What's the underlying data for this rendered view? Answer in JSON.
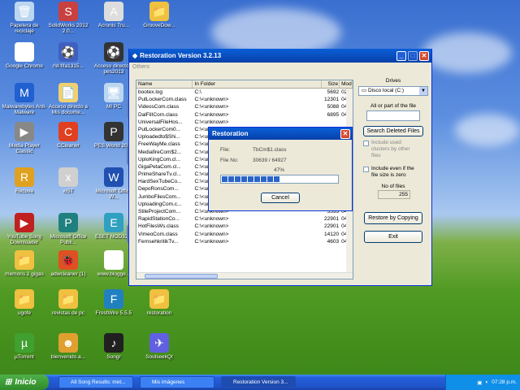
{
  "desktop_icons": [
    {
      "label": "Papelera de reciclaje",
      "icon": "recycle-bin-icon",
      "color": "#bcd6f0",
      "glyph": "🗑"
    },
    {
      "label": "SolidWorks 2012 2.0...",
      "icon": "app-icon",
      "color": "#c84040",
      "glyph": "S"
    },
    {
      "label": "Acronis Tru...",
      "icon": "app-icon",
      "color": "#dddddd",
      "glyph": "A"
    },
    {
      "label": "GrooveDow...",
      "icon": "folder-icon",
      "color": "#f0c040",
      "glyph": "📁"
    },
    {
      "label": "Google Chrome",
      "icon": "chrome-icon",
      "color": "#ffffff",
      "glyph": "◉"
    },
    {
      "label": "rld-fifa1315...",
      "icon": "app-icon",
      "color": "#4060c0",
      "glyph": "⚽"
    },
    {
      "label": "Acceso directo a pes2013",
      "icon": "game-icon",
      "color": "#333333",
      "glyph": "⚽"
    },
    {
      "label": "Malwarebytes Anti-Malware",
      "icon": "malwarebytes-icon",
      "color": "#2060d0",
      "glyph": "M"
    },
    {
      "label": "Acceso directo a Mis docume...",
      "icon": "documents-icon",
      "color": "#f0d070",
      "glyph": "📄"
    },
    {
      "label": "MI PC",
      "icon": "computer-icon",
      "color": "#bcd6f0",
      "glyph": "🖥"
    },
    {
      "label": "aT...",
      "icon": "app-icon",
      "color": "#6080c0",
      "glyph": "a"
    },
    {
      "label": "Media Player Classic",
      "icon": "media-player-icon",
      "color": "#888888",
      "glyph": "▶"
    },
    {
      "label": "CCleaner",
      "icon": "ccleaner-icon",
      "color": "#e04020",
      "glyph": "C"
    },
    {
      "label": "PES World 2012",
      "icon": "game-icon",
      "color": "#333333",
      "glyph": "P"
    },
    {
      "label": "so...",
      "icon": "app-icon",
      "color": "#6080c0",
      "glyph": "s"
    },
    {
      "label": "Recuva",
      "icon": "recuva-icon",
      "color": "#e0a020",
      "glyph": "R"
    },
    {
      "label": "xiST",
      "icon": "app-icon",
      "color": "#d0d0d0",
      "glyph": "x"
    },
    {
      "label": "Microsoft Office W...",
      "icon": "word-icon",
      "color": "#2050b0",
      "glyph": "W"
    },
    {
      "label": "YouTube Song Downloader",
      "icon": "youtube-icon",
      "color": "#c02020",
      "glyph": "▶"
    },
    {
      "label": "Microsoft Office Publi...",
      "icon": "publisher-icon",
      "color": "#208080",
      "glyph": "P"
    },
    {
      "label": "ESET NOD32...",
      "icon": "eset-icon",
      "color": "#30a0c0",
      "glyph": "E"
    },
    {
      "label": "so...",
      "icon": "app-icon",
      "color": "#6080c0",
      "glyph": "s"
    },
    {
      "label": "memoris 2 gigas",
      "icon": "folder-icon",
      "color": "#f0c040",
      "glyph": "📁"
    },
    {
      "label": "adwcleaner (1)",
      "icon": "adwcleaner-icon",
      "color": "#e05020",
      "glyph": "🐞"
    },
    {
      "label": "www.blogge...",
      "icon": "chrome-icon",
      "color": "#ffffff",
      "glyph": "◉"
    },
    {
      "label": "ugofe",
      "icon": "folder-icon",
      "color": "#f0c040",
      "glyph": "📁"
    },
    {
      "label": "revistas de pc",
      "icon": "folder-icon",
      "color": "#f0c040",
      "glyph": "📁"
    },
    {
      "label": "FrostWire 5.5.5",
      "icon": "frostwire-icon",
      "color": "#2080c0",
      "glyph": "F"
    },
    {
      "label": "restoration",
      "icon": "folder-icon",
      "color": "#f0c040",
      "glyph": "📁"
    },
    {
      "label": "µTorrent",
      "icon": "utorrent-icon",
      "color": "#40a030",
      "glyph": "µ"
    },
    {
      "label": "bienvenido.a...",
      "icon": "app-icon",
      "color": "#e0a030",
      "glyph": "☻"
    },
    {
      "label": "Songr",
      "icon": "songr-icon",
      "color": "#202020",
      "glyph": "♪"
    },
    {
      "label": "SoulseekQt",
      "icon": "soulseek-icon",
      "color": "#6060e0",
      "glyph": "✈"
    }
  ],
  "window": {
    "title": "Restoration Version 3.2.13",
    "menu": "Others",
    "columns": [
      "Name",
      "In Folder",
      "Size",
      "Mod"
    ],
    "rows": [
      [
        "bootex.log",
        "C:\\",
        "5692",
        "02/2"
      ],
      [
        "PutLockerCom.class",
        "C:\\<unknown>",
        "12301",
        "04/0"
      ],
      [
        "VideosCom.class",
        "C:\\<unknown>",
        "5088",
        "04/0"
      ],
      [
        "DalFilICom.class",
        "C:\\<unknown>",
        "6895",
        "04/0"
      ],
      [
        "UniversalFileHos...",
        "C:\\<unknown>",
        "",
        ""
      ],
      [
        "PutLockerCom0...",
        "C:\\<unknown>",
        "",
        ""
      ],
      [
        "Uploadedto$Shi...",
        "C:\\<unknown>",
        "",
        ""
      ],
      [
        "FreeWayMe.class",
        "C:\\<unknown>",
        "",
        ""
      ],
      [
        "MediafireCom$2...",
        "C:\\<unknown>",
        "",
        ""
      ],
      [
        "UploKingCom.cl...",
        "C:\\<unknown>",
        "",
        ""
      ],
      [
        "GigaPetaCom.cl...",
        "C:\\<unknown>",
        "",
        ""
      ],
      [
        "PrimeShareTv.cl...",
        "C:\\<unknown>",
        "",
        ""
      ],
      [
        "HardSexTubeCo...",
        "C:\\<unknown>",
        "",
        ""
      ],
      [
        "DepoRonsCom...",
        "C:\\<unknown>",
        "",
        ""
      ],
      [
        "JumboFilesCom...",
        "C:\\<unknown>",
        "11541",
        "04/0"
      ],
      [
        "UploadingCom.c...",
        "C:\\<unknown>",
        "21647",
        "04/0"
      ],
      [
        "StileProjectCom...",
        "C:\\<unknown>",
        "5533",
        "04/0"
      ],
      [
        "RapidStationCo...",
        "C:\\<unknown>",
        "22901",
        "04/0"
      ],
      [
        "HotFilesWs.class",
        "C:\\<unknown>",
        "22901",
        "04/0"
      ],
      [
        "VimeoCom.class",
        "C:\\<unknown>",
        "14120",
        "04/0"
      ],
      [
        "FernsehkritikTv...",
        "C:\\<unknown>",
        "4603",
        "04/0"
      ]
    ],
    "drives_label": "Drives",
    "drive_value": "Disco local (C:)",
    "filter_label": "All or part of the file",
    "search_button": "Search Deleted Files",
    "include_used": "Include used clusters by other files",
    "include_zero": "Include even if the file size is zero",
    "no_of_files_label": "No of files",
    "no_of_files_value": "255",
    "restore_button": "Restore by Copying",
    "exit_button": "Exit"
  },
  "dialog": {
    "title": "Restoration",
    "file_label": "File:",
    "file_value": "TbCm$1.class",
    "fileno_label": "File No:",
    "fileno_value": "30639 / 64927",
    "percent": "47%",
    "progress": 0.47,
    "cancel": "Cancel"
  },
  "taskbar": {
    "start": "Inicio",
    "tasks": [
      "All Song Results: met...",
      "Mis imágenes",
      "Restoration Version 3..."
    ],
    "lang": "ES",
    "clock": "07:28 p.m."
  }
}
